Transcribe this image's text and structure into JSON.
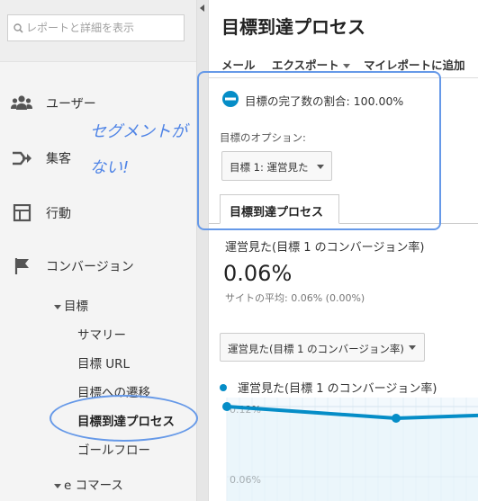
{
  "sidebar": {
    "search_placeholder": "レポートと詳細を表示",
    "nav": [
      {
        "label": "ユーザー",
        "icon": "users-icon"
      },
      {
        "label": "集客",
        "icon": "acquisition-icon"
      },
      {
        "label": "行動",
        "icon": "behavior-icon"
      },
      {
        "label": "コンバージョン",
        "icon": "flag-icon"
      }
    ],
    "goals_label": "目標",
    "goal_items": [
      "サマリー",
      "目標 URL",
      "目標への遷移",
      "目標到達プロセス",
      "ゴールフロー"
    ],
    "ecommerce_label": "e コマース"
  },
  "main": {
    "title": "目標到達プロセス",
    "toolbar": {
      "mail": "メール",
      "export": "エクスポート",
      "my_report": "マイレポートに追加"
    },
    "goal_completion": "目標の完了数の割合: 100.00%",
    "goal_option_label": "目標のオプション:",
    "goal_select": "目標 1: 運営見た",
    "tab_label": "目標到達プロセス",
    "metric_label": "運営見た(目標 1 のコンバージョン率)",
    "metric_value": "0.06%",
    "site_avg_label": "サイトの平均:",
    "site_avg_value": "0.06% (0.00%)",
    "metric_select": "運営見た(目標 1 のコンバージョン率)",
    "legend_label": "運営見た(目標 1 のコンバージョン率)"
  },
  "annotation": {
    "line1": "セグメントが",
    "line2": "ない!"
  },
  "colors": {
    "accent": "#058dc7",
    "annotation": "#6699e8",
    "sidebar_bg": "#f4f4f4"
  },
  "chart_data": {
    "type": "area",
    "series": [
      {
        "values": [
          0.12,
          0.11,
          0.113
        ]
      }
    ],
    "y_tick_labels": [
      "0.12%",
      "0.06%"
    ]
  }
}
